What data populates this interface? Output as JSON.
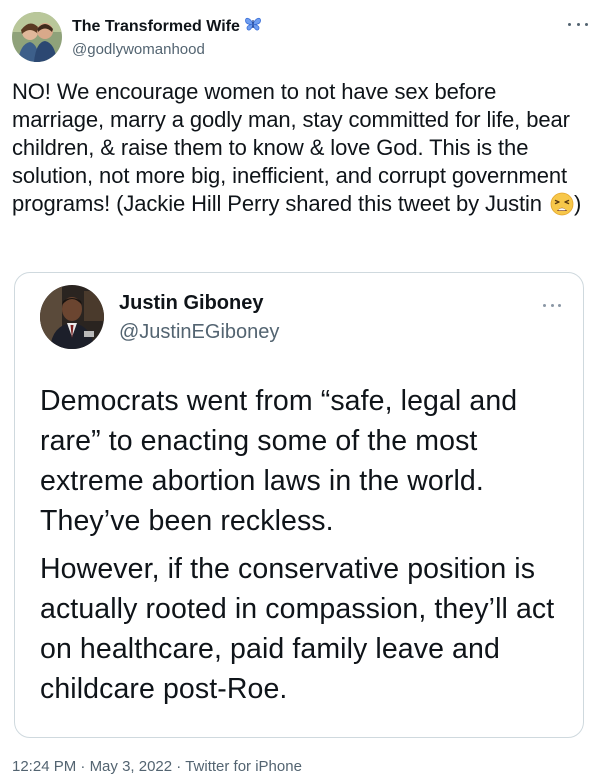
{
  "author": {
    "display_name": "The Transformed Wife",
    "handle": "@godlywomanhood",
    "badge_icon": "butterfly-icon"
  },
  "tweet": {
    "text_before_emoji": "NO! We encourage women to not have sex before marriage, marry a godly man, stay committed for life, bear children, & raise them to know & love God. This is the solution, not more big, inefficient, and corrupt government programs! (Jackie Hill Perry shared this tweet by Justin ",
    "emoji": "tired-face-emoji",
    "text_after_emoji": ")"
  },
  "quoted": {
    "display_name": "Justin Giboney",
    "handle": "@JustinEGiboney",
    "paragraph_1": "Democrats went from “safe, legal and rare” to enacting some of the most extreme abortion laws in the world. They’ve been reckless.",
    "paragraph_2": "However, if the conservative position is actually rooted in compassion, they’ll act on healthcare, paid family leave and childcare post-Roe."
  },
  "footer": {
    "time": "12:24 PM",
    "separator": "·",
    "date": "May 3, 2022",
    "source": "Twitter for iPhone"
  },
  "colors": {
    "text": "#0f1419",
    "secondary": "#536471",
    "border": "#cfd9de",
    "badge": "#3b6fd8"
  }
}
